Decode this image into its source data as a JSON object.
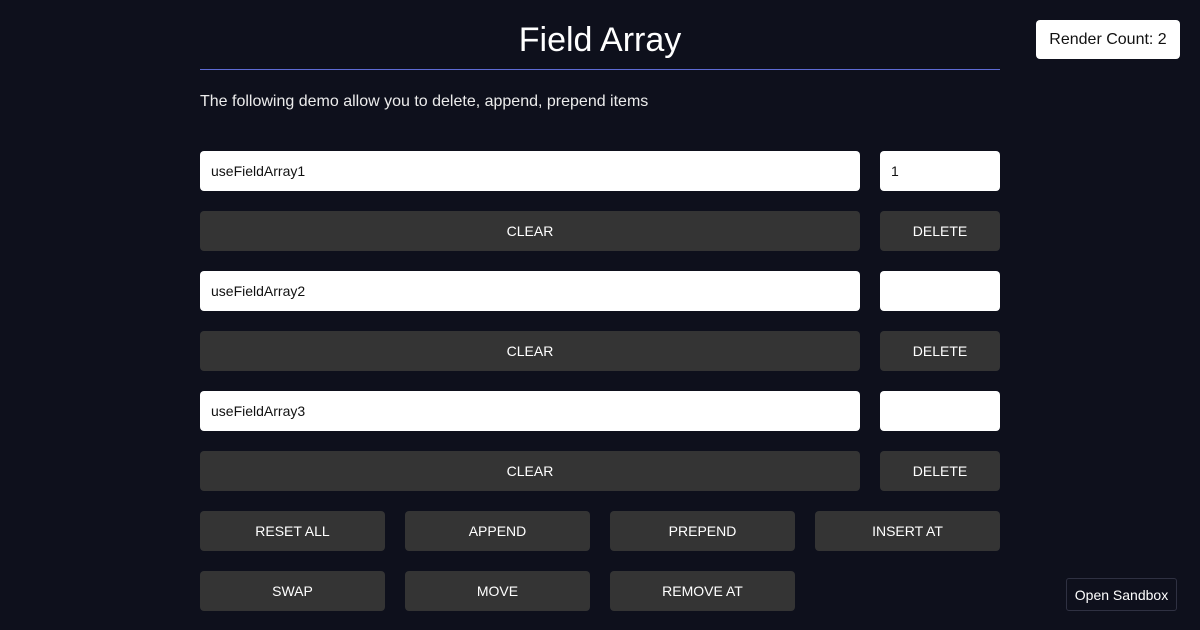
{
  "header": {
    "title": "Field Array",
    "render_count": "Render Count: 2"
  },
  "description": "The following demo allow you to delete, append, prepend items",
  "items": [
    {
      "name": "useFieldArray1",
      "number": "1",
      "clear_label": "CLEAR",
      "delete_label": "DELETE"
    },
    {
      "name": "useFieldArray2",
      "number": "",
      "clear_label": "CLEAR",
      "delete_label": "DELETE"
    },
    {
      "name": "useFieldArray3",
      "number": "",
      "clear_label": "CLEAR",
      "delete_label": "DELETE"
    }
  ],
  "actions": {
    "reset_all": "RESET ALL",
    "append": "APPEND",
    "prepend": "PREPEND",
    "insert_at": "INSERT AT",
    "swap": "SWAP",
    "move": "MOVE",
    "remove_at": "REMOVE AT"
  },
  "footer": {
    "open_sandbox": "Open Sandbox"
  },
  "colors": {
    "background": "#0e101c",
    "button": "#343434",
    "accent_rule": "#5e6bd4",
    "field": "#ffffff"
  }
}
